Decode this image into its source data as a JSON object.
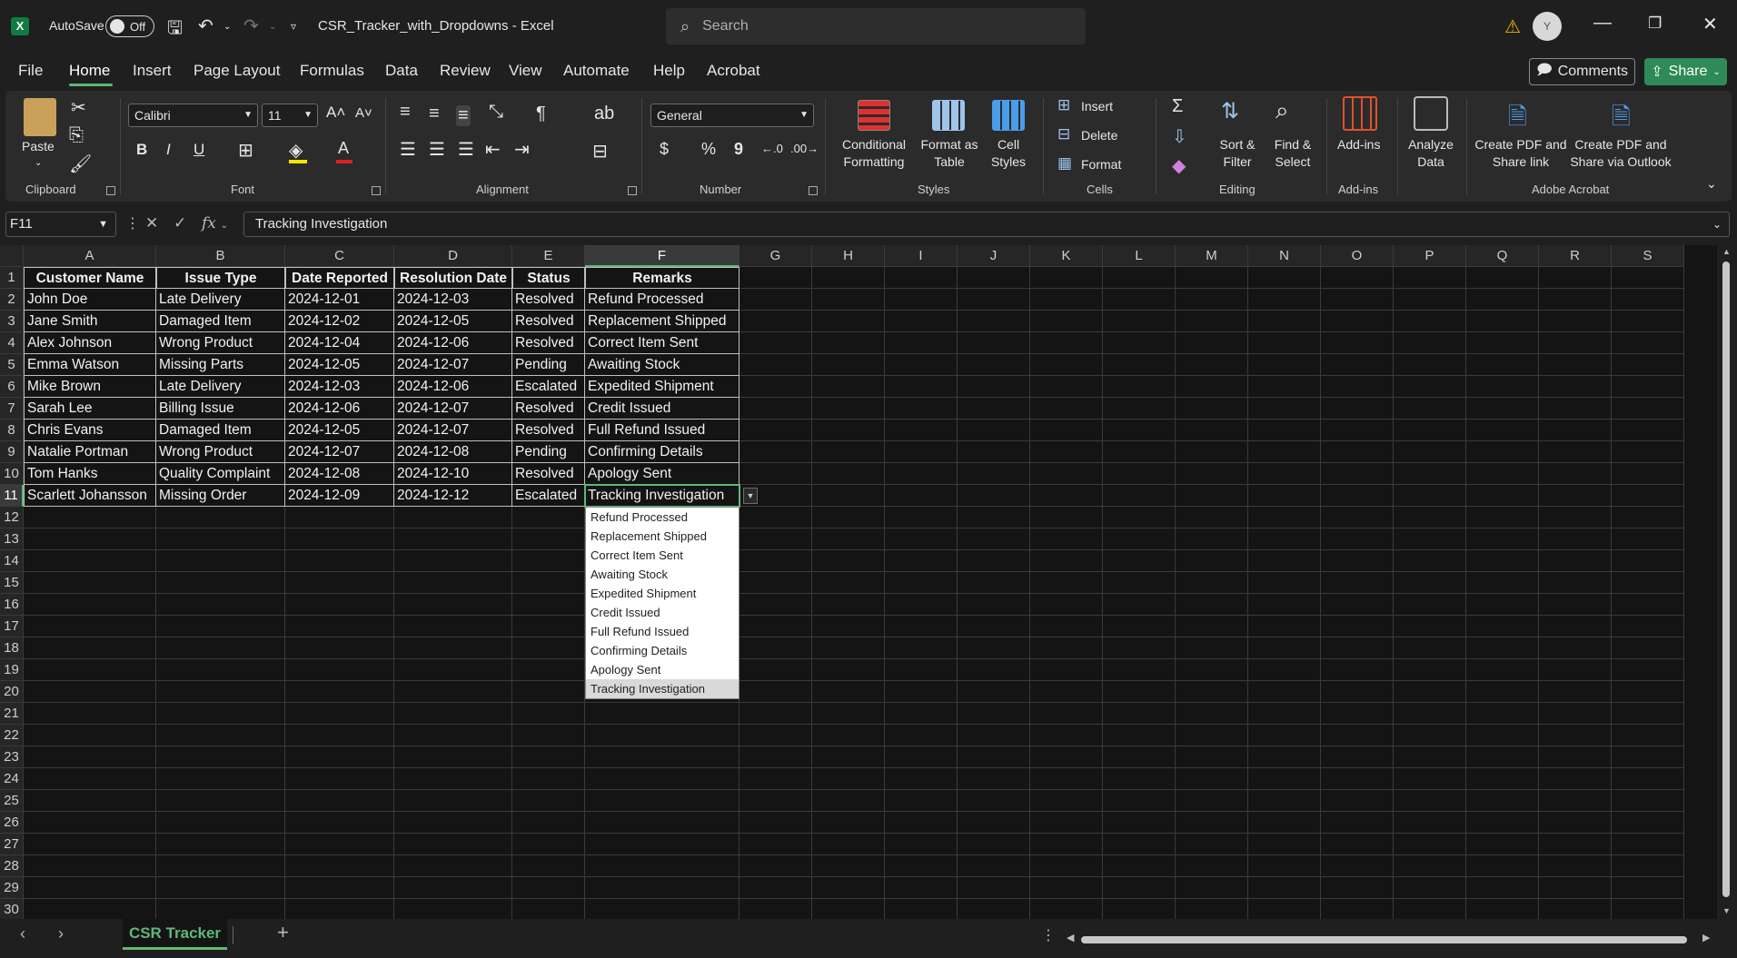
{
  "titlebar": {
    "logo": "X",
    "autosave_label": "AutoSave",
    "autosave_state": "Off",
    "doc_title": "CSR_Tracker_with_Dropdowns  -  Excel",
    "search_placeholder": "Search",
    "avatar_initial": "Y"
  },
  "menu": {
    "items": [
      "File",
      "Home",
      "Insert",
      "Page Layout",
      "Formulas",
      "Data",
      "Review",
      "View",
      "Automate",
      "Help",
      "Acrobat"
    ],
    "active": "Home",
    "comments_label": "Comments",
    "share_label": "Share"
  },
  "ribbon": {
    "clipboard": {
      "label": "Clipboard",
      "paste": "Paste"
    },
    "font": {
      "label": "Font",
      "family": "Calibri",
      "size": "11"
    },
    "alignment": {
      "label": "Alignment"
    },
    "number": {
      "label": "Number",
      "format": "General",
      "currency": "$",
      "percent": "%",
      "comma": "9"
    },
    "styles": {
      "label": "Styles",
      "conditional": "Conditional Formatting",
      "format_table": "Format as Table",
      "cell_styles": "Cell Styles"
    },
    "cells": {
      "label": "Cells",
      "insert": "Insert",
      "delete": "Delete",
      "format": "Format"
    },
    "editing": {
      "label": "Editing",
      "sort": "Sort & Filter",
      "find": "Find & Select"
    },
    "addins": {
      "label": "Add-ins",
      "addins": "Add-ins"
    },
    "analyze": {
      "label": "Analyze Data"
    },
    "acrobat": {
      "label": "Adobe Acrobat",
      "create_share": "Create PDF and Share link",
      "create_outlook": "Create PDF and Share via Outlook"
    }
  },
  "formula_bar": {
    "name_box": "F11",
    "value": "Tracking Investigation"
  },
  "sheet": {
    "columns": [
      "A",
      "B",
      "C",
      "D",
      "E",
      "F",
      "G",
      "H",
      "I",
      "J",
      "K",
      "L",
      "M",
      "N",
      "O",
      "P",
      "Q",
      "R",
      "S"
    ],
    "rows": [
      "1",
      "2",
      "3",
      "4",
      "5",
      "6",
      "7",
      "8",
      "9",
      "10",
      "11",
      "12",
      "13",
      "14",
      "15",
      "16",
      "17",
      "18",
      "19",
      "20",
      "21",
      "22",
      "23",
      "24",
      "25",
      "26",
      "27",
      "28",
      "29",
      "30"
    ],
    "header": [
      "Customer Name",
      "Issue Type",
      "Date Reported",
      "Resolution Date",
      "Status",
      "Remarks"
    ],
    "data": [
      [
        "John Doe",
        "Late Delivery",
        "2024-12-01",
        "2024-12-03",
        "Resolved",
        "Refund Processed"
      ],
      [
        "Jane Smith",
        "Damaged Item",
        "2024-12-02",
        "2024-12-05",
        "Resolved",
        "Replacement Shipped"
      ],
      [
        "Alex Johnson",
        "Wrong Product",
        "2024-12-04",
        "2024-12-06",
        "Resolved",
        "Correct Item Sent"
      ],
      [
        "Emma Watson",
        "Missing Parts",
        "2024-12-05",
        "2024-12-07",
        "Pending",
        "Awaiting Stock"
      ],
      [
        "Mike Brown",
        "Late Delivery",
        "2024-12-03",
        "2024-12-06",
        "Escalated",
        "Expedited Shipment"
      ],
      [
        "Sarah Lee",
        "Billing Issue",
        "2024-12-06",
        "2024-12-07",
        "Resolved",
        "Credit Issued"
      ],
      [
        "Chris Evans",
        "Damaged Item",
        "2024-12-05",
        "2024-12-07",
        "Resolved",
        "Full Refund Issued"
      ],
      [
        "Natalie Portman",
        "Wrong Product",
        "2024-12-07",
        "2024-12-08",
        "Pending",
        "Confirming Details"
      ],
      [
        "Tom Hanks",
        "Quality Complaint",
        "2024-12-08",
        "2024-12-10",
        "Resolved",
        "Apology Sent"
      ],
      [
        "Scarlett Johansson",
        "Missing Order",
        "2024-12-09",
        "2024-12-12",
        "Escalated",
        "Tracking Investigation"
      ]
    ],
    "dropdown_options": [
      "Refund Processed",
      "Replacement Shipped",
      "Correct Item Sent",
      "Awaiting Stock",
      "Expedited Shipment",
      "Credit Issued",
      "Full Refund Issued",
      "Confirming Details",
      "Apology Sent",
      "Tracking Investigation"
    ],
    "dropdown_selected": "Tracking Investigation",
    "active_col": "F",
    "active_row": "11"
  },
  "tabs": {
    "active": "CSR Tracker"
  }
}
